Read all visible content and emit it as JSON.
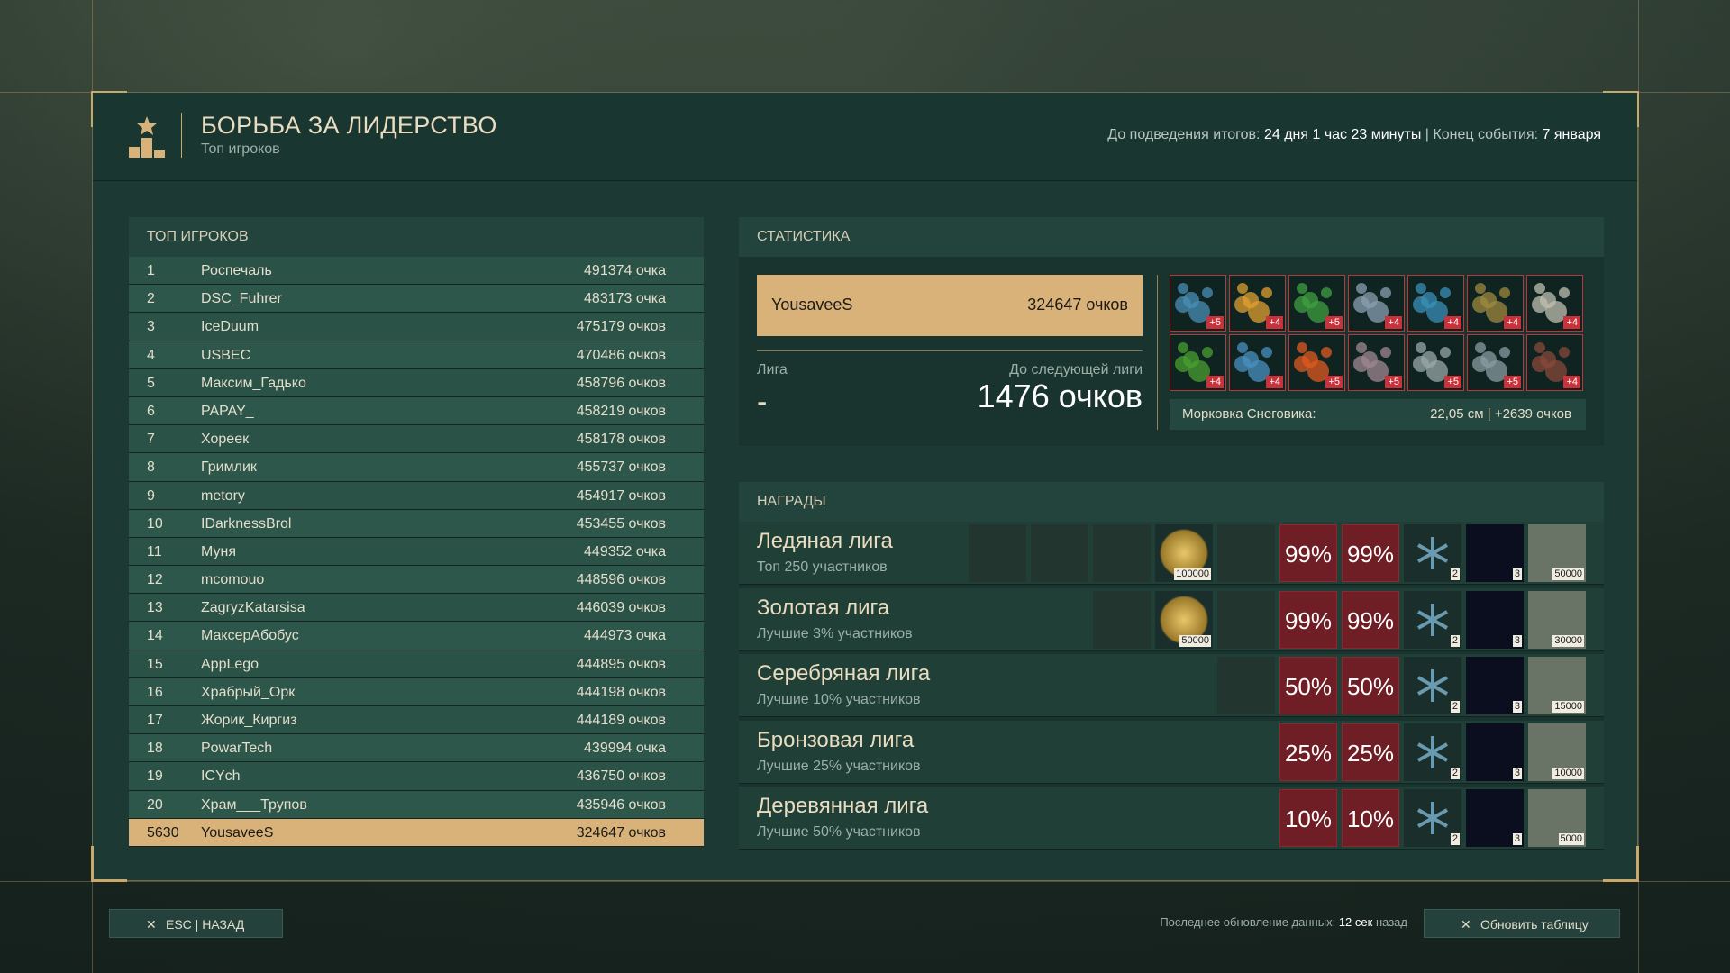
{
  "header": {
    "title": "БОРЬБА ЗА ЛИДЕРСТВО",
    "subtitle": "Топ игроков",
    "summary_label": "До подведения итогов:",
    "summary_value": "24 дня 1 час 23 минуты",
    "separator": "|",
    "end_label": "Конец события:",
    "end_value": "7 января"
  },
  "top_players": {
    "title": "ТОП ИГРОКОВ",
    "rows": [
      {
        "rank": "1",
        "name": "Роспечаль",
        "score": "491374 очка"
      },
      {
        "rank": "2",
        "name": "DSC_Fuhrer",
        "score": "483173 очка"
      },
      {
        "rank": "3",
        "name": "IceDuum",
        "score": "475179 очков"
      },
      {
        "rank": "4",
        "name": "USBEC",
        "score": "470486 очков"
      },
      {
        "rank": "5",
        "name": "Максим_Гадько",
        "score": "458796 очков"
      },
      {
        "rank": "6",
        "name": "PAPAY_",
        "score": "458219 очков"
      },
      {
        "rank": "7",
        "name": "Хореек",
        "score": "458178 очков"
      },
      {
        "rank": "8",
        "name": "Гримлик",
        "score": "455737 очков"
      },
      {
        "rank": "9",
        "name": "metory",
        "score": "454917 очков"
      },
      {
        "rank": "10",
        "name": "IDarknessBrol",
        "score": "453455 очков"
      },
      {
        "rank": "11",
        "name": "Муня",
        "score": "449352 очка"
      },
      {
        "rank": "12",
        "name": "mcomouo",
        "score": "448596 очков"
      },
      {
        "rank": "13",
        "name": "ZagryzKatarsisa",
        "score": "446039 очков"
      },
      {
        "rank": "14",
        "name": "МаксерАбобус",
        "score": "444973 очка"
      },
      {
        "rank": "15",
        "name": "AppLego",
        "score": "444895 очков"
      },
      {
        "rank": "16",
        "name": "Храбрый_Орк",
        "score": "444198 очков"
      },
      {
        "rank": "17",
        "name": "Жорик_Киргиз",
        "score": "444189 очков"
      },
      {
        "rank": "18",
        "name": "PowarTech",
        "score": "439994 очка"
      },
      {
        "rank": "19",
        "name": "ICYch",
        "score": "436750 очков"
      },
      {
        "rank": "20",
        "name": "Храм___Трупов",
        "score": "435946 очков"
      }
    ],
    "self": {
      "rank": "5630",
      "name": "YousaveeS",
      "score": "324647 очков"
    }
  },
  "stats": {
    "title": "СТАТИСТИКА",
    "player_name": "YousaveeS",
    "player_score": "324647 очков",
    "league_label": "Лига",
    "league_value": "-",
    "next_label": "До следующей лиги",
    "next_value": "1476 очков",
    "items": [
      {
        "icon": "blue-urchin-icon",
        "badge": "+5",
        "color": "#4a8fb5"
      },
      {
        "icon": "flames-icon",
        "badge": "+4",
        "color": "#e0a030"
      },
      {
        "icon": "green-leaves-icon",
        "badge": "+5",
        "color": "#3fa040"
      },
      {
        "icon": "hook-icon",
        "badge": "+4",
        "color": "#8aa0b0"
      },
      {
        "icon": "blue-blob-icon",
        "badge": "+4",
        "color": "#3a90b8"
      },
      {
        "icon": "coiled-worm-icon",
        "badge": "+4",
        "color": "#a08a40"
      },
      {
        "icon": "fly-icon",
        "badge": "+4",
        "color": "#c0c0b0"
      },
      {
        "icon": "green-grass-icon",
        "badge": "+4",
        "color": "#4aa030"
      },
      {
        "icon": "blue-crystals-icon",
        "badge": "+4",
        "color": "#4a90c0"
      },
      {
        "icon": "orange-chains-icon",
        "badge": "+5",
        "color": "#e05a20"
      },
      {
        "icon": "pink-rock-icon",
        "badge": "+5",
        "color": "#a08890"
      },
      {
        "icon": "hedgehog-icon",
        "badge": "+5",
        "color": "#9aa8a8"
      },
      {
        "icon": "grey-urchin-icon",
        "badge": "+5",
        "color": "#8a9ca0"
      },
      {
        "icon": "claw-icon",
        "badge": "+4",
        "color": "#8a4a3a"
      }
    ],
    "carrot_label": "Морковка Снеговика:",
    "carrot_value": "22,05 см  |  +2639 очков"
  },
  "rewards": {
    "title": "НАГРАДЫ",
    "leagues": [
      {
        "name": "Ледяная лига",
        "sub": "Топ 250 участников",
        "pct1": "99%",
        "pct2": "99%",
        "cnt_snow": "2",
        "cnt_space": "3",
        "cnt_map": "50000",
        "extras": [
          {
            "icon": "armor-icon"
          },
          {
            "icon": "device-icon"
          },
          {
            "icon": "rifle-icon"
          },
          {
            "icon": "gold-coin-icon",
            "cnt": "100000"
          },
          {
            "icon": "knife-icon"
          }
        ]
      },
      {
        "name": "Золотая лига",
        "sub": "Лучшие 3% участников",
        "pct1": "99%",
        "pct2": "99%",
        "cnt_snow": "2",
        "cnt_space": "3",
        "cnt_map": "30000",
        "extras": [
          {
            "icon": "rifle-icon"
          },
          {
            "icon": "gold-coin-icon",
            "cnt": "50000"
          },
          {
            "icon": "knife-icon"
          }
        ]
      },
      {
        "name": "Серебряная лига",
        "sub": "Лучшие 10% участников",
        "pct1": "50%",
        "pct2": "50%",
        "cnt_snow": "2",
        "cnt_space": "3",
        "cnt_map": "15000",
        "extras": [
          {
            "icon": "knife-icon"
          }
        ]
      },
      {
        "name": "Бронзовая лига",
        "sub": "Лучшие 25% участников",
        "pct1": "25%",
        "pct2": "25%",
        "cnt_snow": "2",
        "cnt_space": "3",
        "cnt_map": "10000",
        "extras": []
      },
      {
        "name": "Деревянная лига",
        "sub": "Лучшие 50% участников",
        "pct1": "10%",
        "pct2": "10%",
        "cnt_snow": "2",
        "cnt_space": "3",
        "cnt_map": "5000",
        "extras": []
      }
    ]
  },
  "footer": {
    "back_label": "ESC | НАЗАД",
    "update_label": "Последнее обновление данных:",
    "update_value": "12 сек",
    "update_suffix": "назад",
    "refresh_label": "Обновить таблицу"
  }
}
